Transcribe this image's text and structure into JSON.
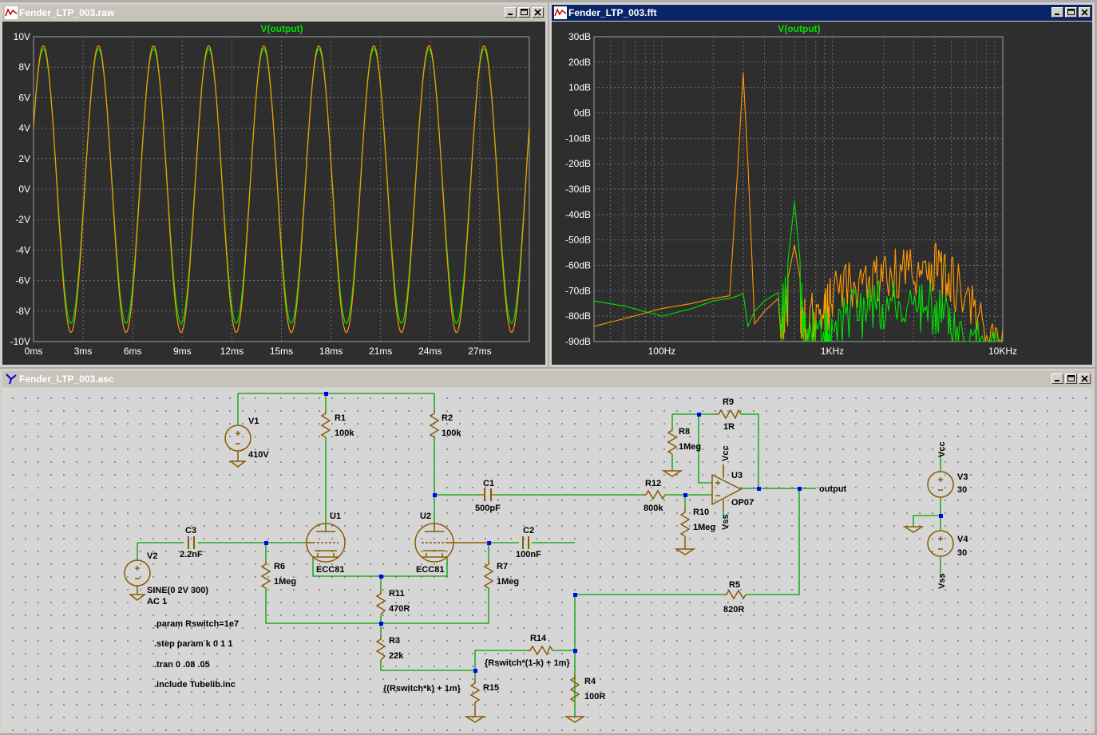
{
  "windows": {
    "raw": {
      "title": "Fender_LTP_003.raw",
      "trace": "V(output)",
      "y_ticks": [
        "10V",
        "8V",
        "6V",
        "4V",
        "2V",
        "0V",
        "-2V",
        "-4V",
        "-6V",
        "-8V",
        "-10V"
      ],
      "x_ticks": [
        "0ms",
        "3ms",
        "6ms",
        "9ms",
        "12ms",
        "15ms",
        "18ms",
        "21ms",
        "24ms",
        "27ms"
      ]
    },
    "fft": {
      "title": "Fender_LTP_003.fft",
      "trace": "V(output)",
      "y_ticks": [
        "30dB",
        "20dB",
        "10dB",
        "0dB",
        "-10dB",
        "-20dB",
        "-30dB",
        "-40dB",
        "-50dB",
        "-60dB",
        "-70dB",
        "-80dB",
        "-90dB"
      ],
      "x_ticks": [
        "100Hz",
        "1KHz",
        "10KHz"
      ]
    },
    "schematic": {
      "title": "Fender_LTP_003.asc"
    }
  },
  "colors": {
    "trace_green": "#00e000",
    "trace_orange": "#ff9900",
    "plot_bg": "#2e2e2e",
    "grid": "#707070",
    "wire": "#00a000",
    "component": "#8a5a00",
    "title_active": "#0a246a",
    "title_inactive": "#c7c3bb"
  },
  "chart_data": [
    {
      "type": "line",
      "title": "V(output)",
      "xlabel": "",
      "ylabel": "",
      "x_unit": "ms",
      "y_unit": "V",
      "xlim": [
        0,
        30
      ],
      "ylim": [
        -10,
        10
      ],
      "grid": true,
      "series": [
        {
          "color": "#00e000",
          "waveform": "sine",
          "frequency_hz": 300,
          "amplitude": 9.0,
          "offset": 0.2
        },
        {
          "color": "#ff9900",
          "waveform": "sine",
          "frequency_hz": 300,
          "amplitude": 9.4,
          "offset": 0.0
        }
      ]
    },
    {
      "type": "line",
      "title": "V(output)",
      "xlabel": "",
      "ylabel": "",
      "x_unit": "Hz",
      "y_unit": "dB",
      "x_scale": "log",
      "xlim": [
        40,
        10000
      ],
      "ylim": [
        -90,
        30
      ],
      "grid": true,
      "series": [
        {
          "color": "#ff9900",
          "x": [
            40,
            60,
            100,
            150,
            200,
            250,
            280,
            300,
            320,
            350,
            400,
            500,
            550,
            600,
            650,
            700,
            900,
            1000,
            1500,
            2000,
            3000,
            4000,
            5000,
            7000,
            10000
          ],
          "y": [
            -84,
            -81,
            -77,
            -75,
            -73,
            -72,
            -20,
            16,
            -20,
            -83,
            -78,
            -72,
            -65,
            -52,
            -66,
            -72,
            -66,
            -62,
            -55,
            -52,
            -50,
            -50,
            -55,
            -70,
            -85
          ]
        },
        {
          "color": "#00e000",
          "x": [
            40,
            60,
            100,
            150,
            200,
            250,
            280,
            300,
            320,
            350,
            400,
            500,
            550,
            600,
            650,
            700,
            900,
            1000,
            1500,
            2000,
            3000,
            4000,
            5000,
            7000,
            10000
          ],
          "y": [
            -74,
            -76,
            -80,
            -77,
            -74,
            -73,
            -72,
            -71,
            -84,
            -78,
            -74,
            -70,
            -58,
            -35,
            -60,
            -75,
            -77,
            -72,
            -68,
            -64,
            -68,
            -66,
            -74,
            -80,
            -88
          ]
        }
      ]
    }
  ],
  "schematic": {
    "labels": {
      "V1": "V1",
      "V1val": "410V",
      "R1": "R1",
      "R1val": "100k",
      "R2": "R2",
      "R2val": "100k",
      "C1": "C1",
      "C1val": "500pF",
      "R12": "R12",
      "R12val": "800k",
      "R8": "R8",
      "R8val": "1Meg",
      "R9": "R9",
      "R9val": "1R",
      "R10": "R10",
      "R10val": "1Meg",
      "U3": "U3",
      "U3val": "OP07",
      "Vcc": "Vcc",
      "Vss": "Vss",
      "output": "output",
      "V3": "V3",
      "V3val": "30",
      "V4": "V4",
      "V4val": "30",
      "U1": "U1",
      "U1val": "ECC81",
      "U2": "U2",
      "U2val": "ECC81",
      "C3": "C3",
      "C3val": "2.2nF",
      "C2": "C2",
      "C2val": "100nF",
      "V2": "V2",
      "V2val1": "SINE(0 2V 300)",
      "V2val2": "AC 1",
      "R6": "R6",
      "R6val": "1Meg",
      "R7": "R7",
      "R7val": "1Meg",
      "R11": "R11",
      "R11val": "470R",
      "R3": "R3",
      "R3val": "22k",
      "R5": "R5",
      "R5val": "820R",
      "R14": "R14",
      "R14val": "{Rswitch*(1-k) + 1m}",
      "R15": "R15",
      "R15val": "{(Rswitch*k) + 1m}",
      "R4": "R4",
      "R4val": "100R"
    },
    "directives": [
      ".param Rswitch=1e7",
      ".step param k 0 1 1",
      ".tran 0 .08 .05",
      ".include Tubelib.inc"
    ]
  }
}
